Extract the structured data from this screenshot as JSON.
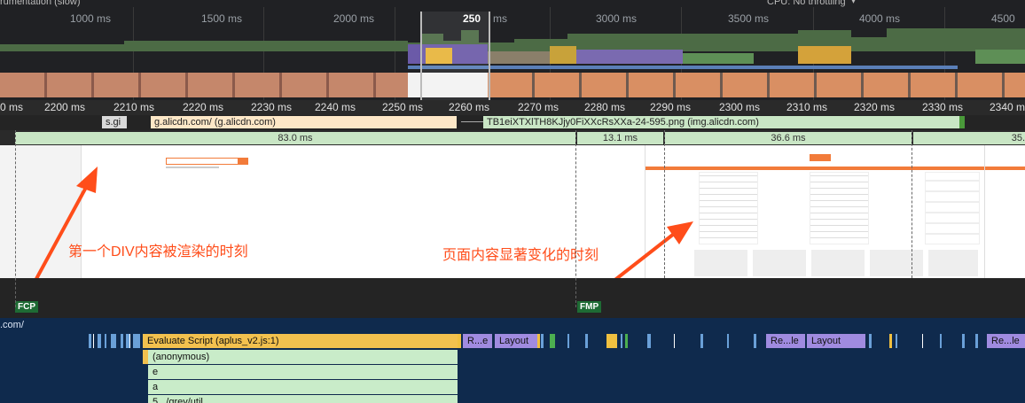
{
  "overview": {
    "header_left": "rumentation (slow)",
    "header_right": "CPU:  No throttling",
    "ticks": [
      "1000 ms",
      "1500 ms",
      "2000 ms",
      "2500 ms",
      "3000 ms",
      "3500 ms",
      "4000 ms",
      "4500 ms"
    ],
    "selection_label": "250",
    "selection_suffix": "ms"
  },
  "detail_ruler": {
    "ticks": [
      "0 ms",
      "2200 ms",
      "2210 ms",
      "2220 ms",
      "2230 ms",
      "2240 ms",
      "2250 ms",
      "2260 ms",
      "2270 ms",
      "2280 ms",
      "2290 ms",
      "2300 ms",
      "2310 ms",
      "2320 ms",
      "2330 ms",
      "2340 m"
    ]
  },
  "network": {
    "bars": [
      {
        "label": "s.gi",
        "color": "#d9d9d9"
      },
      {
        "label": "g.alicdn.com/ (g.alicdn.com)",
        "color": "#fde7c7"
      },
      {
        "label": "TB1eiXTXlTH8KJjy0FiXXcRsXXa-24-595.png (img.alicdn.com)",
        "color": "#c9e6c5"
      }
    ]
  },
  "frames": {
    "segments": [
      "83.0 ms",
      "13.1 ms",
      "36.6 ms",
      "35."
    ]
  },
  "markers": {
    "fcp": "FCP",
    "fmp": "FMP"
  },
  "annotations": {
    "first": "第一个DIV内容被渲染的时刻",
    "second": "页面内容显著变化的时刻"
  },
  "main_thread": {
    "track_label": ".com/",
    "rows": [
      {
        "label": "Evaluate Script (aplus_v2.js:1)"
      },
      {
        "label": "(anonymous)"
      },
      {
        "label": "e"
      },
      {
        "label": "a"
      },
      {
        "label": "5.../grey/util..."
      }
    ],
    "recalc_label": "R...e",
    "layout_label": "Layout",
    "recalc2_label": "Re...le",
    "layout2_label": "Layout",
    "recalc3_label": "Re...le"
  }
}
